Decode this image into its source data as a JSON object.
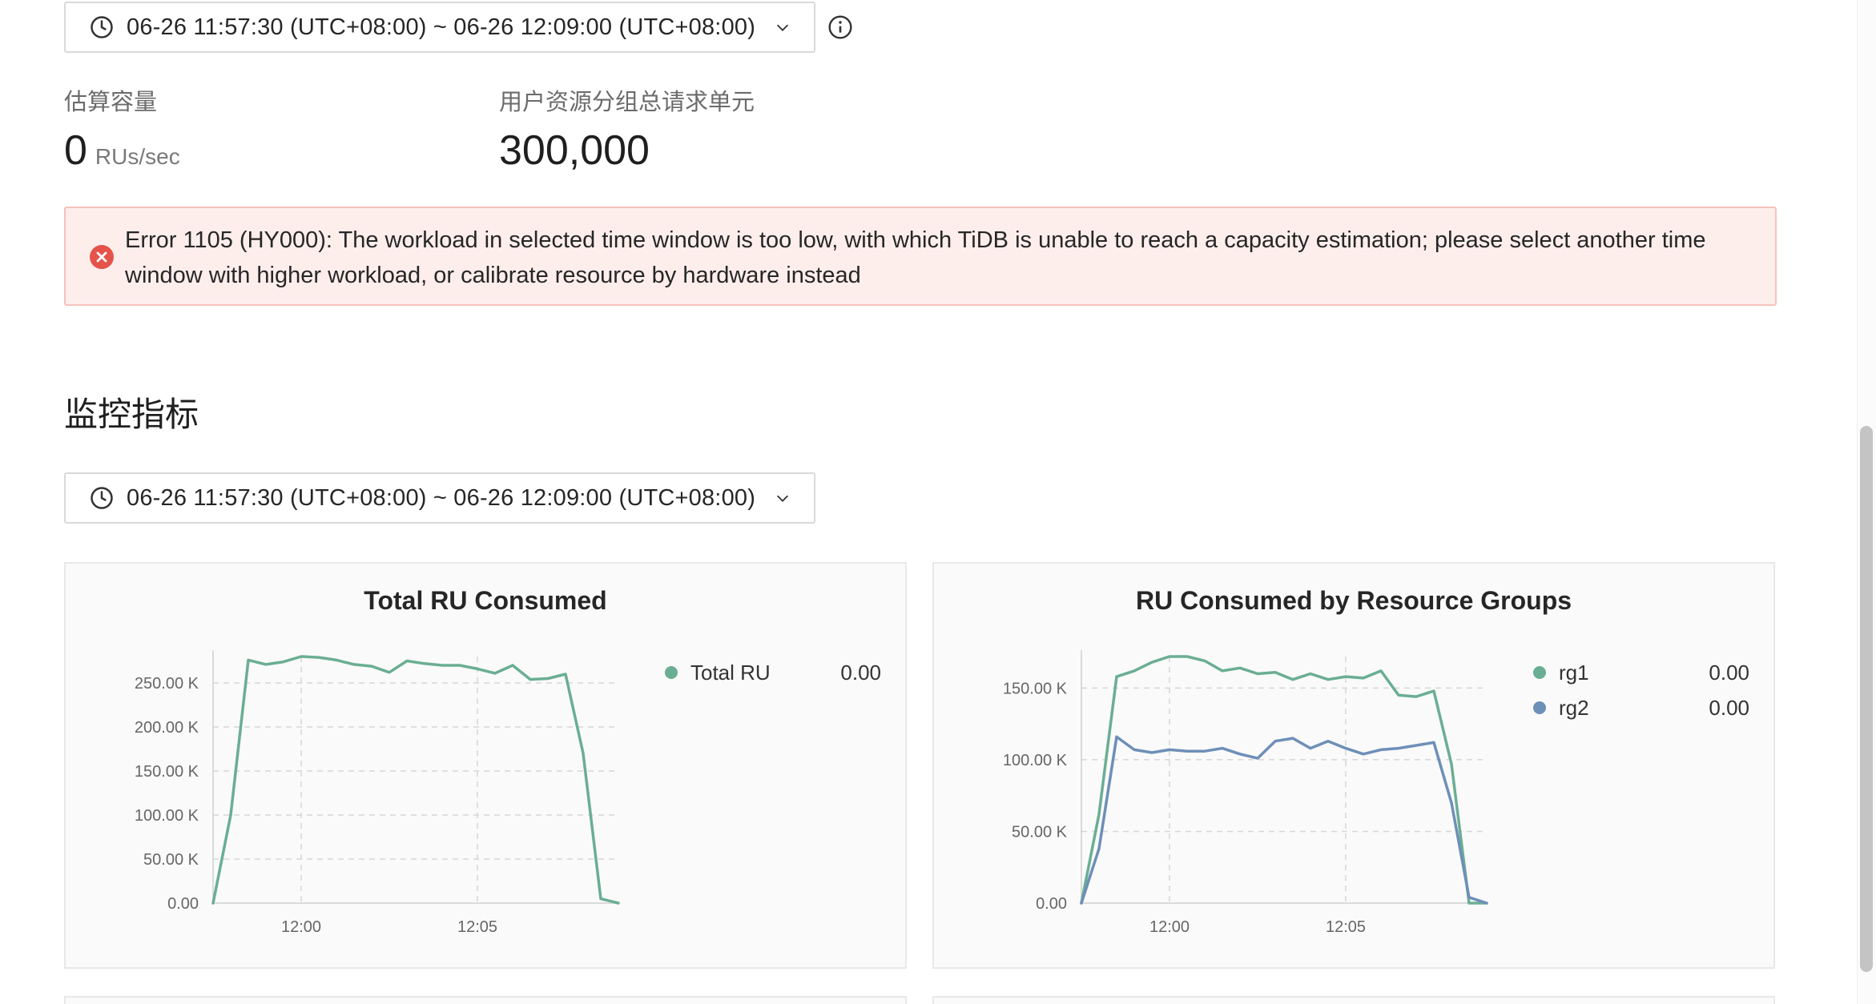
{
  "capacity_time_range": "06-26 11:57:30 (UTC+08:00) ~ 06-26 12:09:00 (UTC+08:00)",
  "stats": {
    "estimated_capacity_label": "估算容量",
    "estimated_capacity_value": "0",
    "estimated_capacity_unit": "RUs/sec",
    "total_request_units_label": "用户资源分组总请求单元",
    "total_request_units_value": "300,000"
  },
  "alert": {
    "message": "Error 1105 (HY000): The workload in selected time window is too low, with which TiDB is unable to reach a capacity estimation; please select another time window with higher workload, or calibrate resource by hardware instead",
    "color": "#e5534b"
  },
  "metrics": {
    "title": "监控指标",
    "time_range": "06-26 11:57:30 (UTC+08:00) ~ 06-26 12:09:00 (UTC+08:00)"
  },
  "icons": [
    "clock-icon",
    "chevron-down-icon",
    "info-icon",
    "error-icon"
  ],
  "chart_data": [
    {
      "type": "line",
      "title": "Total RU Consumed",
      "x": [
        "11:57:30",
        "11:58:00",
        "11:58:30",
        "11:59:00",
        "11:59:30",
        "12:00:00",
        "12:00:30",
        "12:01:00",
        "12:01:30",
        "12:02:00",
        "12:02:30",
        "12:03:00",
        "12:03:30",
        "12:04:00",
        "12:04:30",
        "12:05:00",
        "12:05:30",
        "12:06:00",
        "12:06:30",
        "12:07:00",
        "12:07:30",
        "12:08:00",
        "12:08:30",
        "12:09:00"
      ],
      "xticks": [
        "12:00",
        "12:05"
      ],
      "yticks": [
        "0.00",
        "50.00 K",
        "100.00 K",
        "150.00 K",
        "200.00 K",
        "250.00 K"
      ],
      "ylim": [
        0,
        280000
      ],
      "legend_position": "right",
      "grid": true,
      "series": [
        {
          "name": "Total RU",
          "legend_value": "0.00",
          "color": "#6aae93",
          "values": [
            0,
            100000,
            276000,
            271000,
            274000,
            280000,
            279000,
            276000,
            271000,
            269000,
            262000,
            275000,
            272000,
            270000,
            270000,
            266000,
            261000,
            270000,
            254000,
            255000,
            260000,
            170000,
            5000,
            0
          ]
        }
      ]
    },
    {
      "type": "line",
      "title": "RU Consumed by Resource Groups",
      "x": [
        "11:57:30",
        "11:58:00",
        "11:58:30",
        "11:59:00",
        "11:59:30",
        "12:00:00",
        "12:00:30",
        "12:01:00",
        "12:01:30",
        "12:02:00",
        "12:02:30",
        "12:03:00",
        "12:03:30",
        "12:04:00",
        "12:04:30",
        "12:05:00",
        "12:05:30",
        "12:06:00",
        "12:06:30",
        "12:07:00",
        "12:07:30",
        "12:08:00",
        "12:08:30",
        "12:09:00"
      ],
      "xticks": [
        "12:00",
        "12:05"
      ],
      "yticks": [
        "0.00",
        "50.00 K",
        "100.00 K",
        "150.00 K"
      ],
      "ylim": [
        0,
        172000
      ],
      "legend_position": "right",
      "grid": true,
      "series": [
        {
          "name": "rg1",
          "legend_value": "0.00",
          "color": "#6aae93",
          "values": [
            0,
            62000,
            158000,
            162000,
            168000,
            172000,
            172000,
            169000,
            162000,
            164000,
            160000,
            161000,
            156000,
            160000,
            156000,
            158000,
            157000,
            162000,
            145000,
            144000,
            148000,
            97000,
            0,
            0
          ]
        },
        {
          "name": "rg2",
          "legend_value": "0.00",
          "color": "#6d8fb8",
          "values": [
            0,
            38000,
            116000,
            107000,
            105000,
            107000,
            106000,
            106000,
            108000,
            104000,
            101000,
            113000,
            115000,
            108000,
            113000,
            108000,
            104000,
            107000,
            108000,
            110000,
            112000,
            70000,
            4000,
            0
          ]
        }
      ]
    }
  ]
}
